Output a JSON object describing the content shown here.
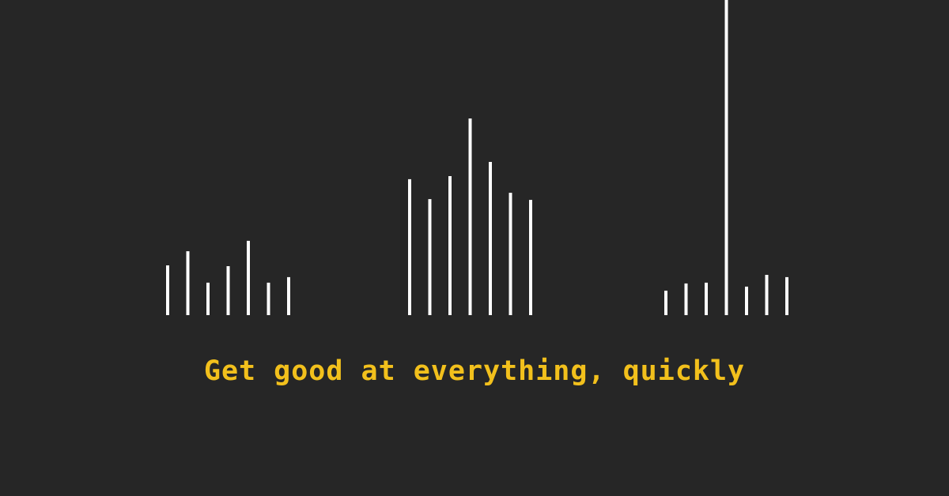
{
  "tagline": "Get good at everything, quickly",
  "colors": {
    "background": "#262626",
    "bars": "#ffffff",
    "tagline": "#f2c01c"
  },
  "bar_groups": [
    {
      "name": "bar-group-left",
      "bars": [
        0.253,
        0.325,
        0.165,
        0.249,
        0.378,
        0.165,
        0.193
      ]
    },
    {
      "name": "bar-group-middle",
      "bars": [
        0.691,
        0.59,
        0.707,
        1.0,
        0.779,
        0.622,
        0.586
      ]
    },
    {
      "name": "bar-group-right",
      "bars": [
        0.124,
        0.161,
        0.165,
        1.61,
        0.145,
        0.205,
        0.193
      ]
    }
  ]
}
